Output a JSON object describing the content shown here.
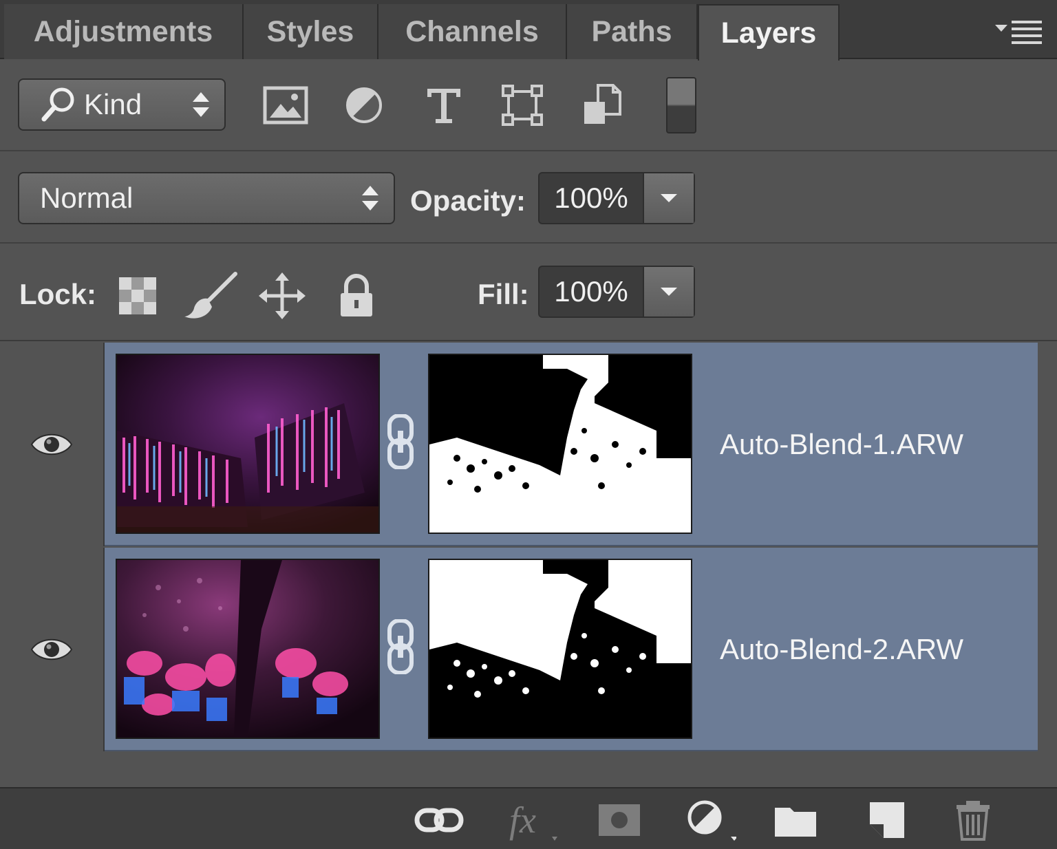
{
  "tabs": [
    {
      "label": "Adjustments",
      "active": false
    },
    {
      "label": "Styles",
      "active": false
    },
    {
      "label": "Channels",
      "active": false
    },
    {
      "label": "Paths",
      "active": false
    },
    {
      "label": "Layers",
      "active": true
    }
  ],
  "filter": {
    "kind_label": "Kind",
    "icons": [
      "image-filter-icon",
      "adjustment-filter-icon",
      "type-filter-icon",
      "shape-filter-icon",
      "smart-object-filter-icon"
    ]
  },
  "blend": {
    "mode": "Normal",
    "opacity_label": "Opacity:",
    "opacity_value": "100%"
  },
  "lock": {
    "label": "Lock:",
    "icons": [
      "lock-transparent-pixels-icon",
      "lock-image-pixels-icon",
      "lock-position-icon",
      "lock-all-icon"
    ],
    "fill_label": "Fill:",
    "fill_value": "100%"
  },
  "layers": [
    {
      "name": "Auto-Blend-1.ARW",
      "visible": true,
      "selected": true
    },
    {
      "name": "Auto-Blend-2.ARW",
      "visible": true,
      "selected": true
    }
  ],
  "footer_icons": [
    "link-layers-icon",
    "fx-icon",
    "add-mask-icon",
    "new-adjustment-layer-icon",
    "new-group-icon",
    "new-layer-icon",
    "delete-layer-icon"
  ],
  "colors": {
    "panel": "#535353",
    "selected_layer": "#6c7c96",
    "tabbar": "#3c3c3c"
  }
}
